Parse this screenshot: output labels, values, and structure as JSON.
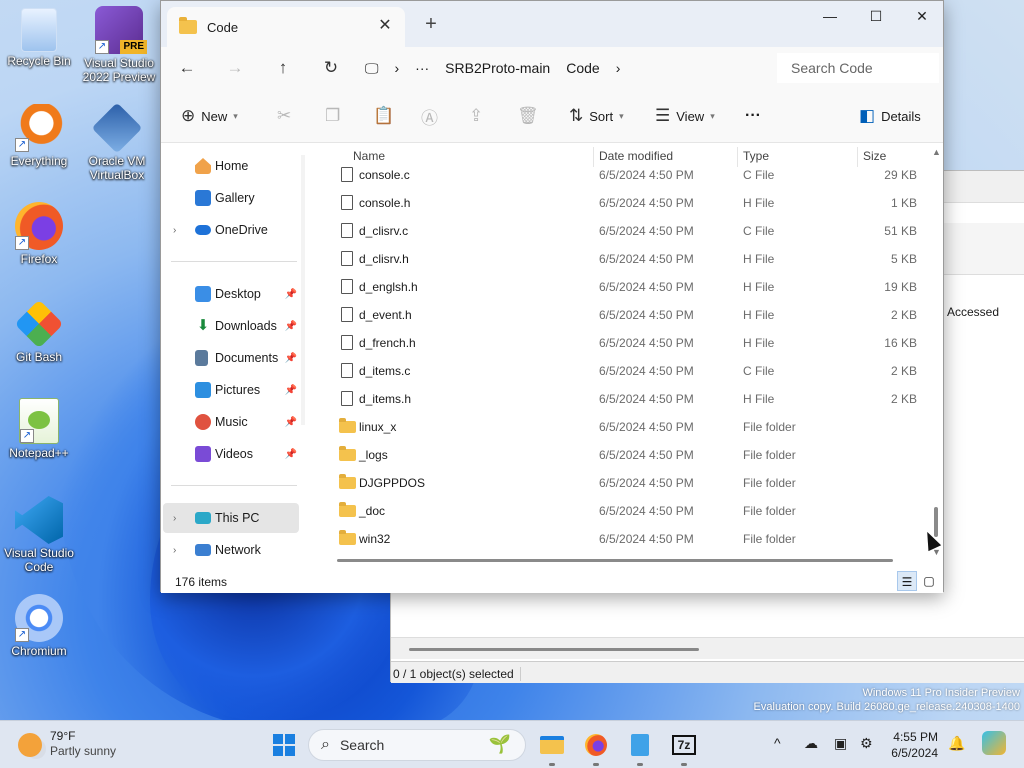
{
  "desktop": {
    "icons": [
      {
        "label": "Recycle Bin",
        "icon": "recycle-bin-icon"
      },
      {
        "label": "Visual Studio 2022 Preview",
        "icon": "visual-studio-preview-icon",
        "badge": "PRE"
      },
      {
        "label": "Everything",
        "icon": "everything-search-icon"
      },
      {
        "label": "Oracle VM VirtualBox",
        "icon": "virtualbox-icon"
      },
      {
        "label": "Firefox",
        "icon": "firefox-icon"
      },
      {
        "label": "Git Bash",
        "icon": "git-bash-icon"
      },
      {
        "label": "Notepad++",
        "icon": "notepad-plus-plus-icon"
      },
      {
        "label": "Visual Studio Code",
        "icon": "vscode-icon"
      },
      {
        "label": "Chromium",
        "icon": "chromium-icon"
      }
    ]
  },
  "background_window": {
    "column_header": "Accessed",
    "status": "0 / 1 object(s) selected"
  },
  "explorer": {
    "tab_title": "Code",
    "window_controls": {
      "minimize": "—",
      "maximize": "☐",
      "close": "✕"
    },
    "breadcrumb": [
      "SRB2Proto-main",
      "Code"
    ],
    "breadcrumb_more": "···",
    "search_placeholder": "Search Code",
    "commands": {
      "new": "New",
      "sort": "Sort",
      "view": "View",
      "more": "···",
      "details": "Details"
    },
    "nav": {
      "home": "Home",
      "gallery": "Gallery",
      "onedrive": "OneDrive",
      "desktop": "Desktop",
      "downloads": "Downloads",
      "documents": "Documents",
      "pictures": "Pictures",
      "music": "Music",
      "videos": "Videos",
      "this_pc": "This PC",
      "network": "Network"
    },
    "columns": {
      "name": "Name",
      "date": "Date modified",
      "type": "Type",
      "size": "Size"
    },
    "files": [
      {
        "name": "console.c",
        "date": "6/5/2024 4:50 PM",
        "type": "C File",
        "size": "29 KB",
        "kind": "file"
      },
      {
        "name": "console.h",
        "date": "6/5/2024 4:50 PM",
        "type": "H File",
        "size": "1 KB",
        "kind": "file"
      },
      {
        "name": "d_clisrv.c",
        "date": "6/5/2024 4:50 PM",
        "type": "C File",
        "size": "51 KB",
        "kind": "file"
      },
      {
        "name": "d_clisrv.h",
        "date": "6/5/2024 4:50 PM",
        "type": "H File",
        "size": "5 KB",
        "kind": "file"
      },
      {
        "name": "d_englsh.h",
        "date": "6/5/2024 4:50 PM",
        "type": "H File",
        "size": "19 KB",
        "kind": "file"
      },
      {
        "name": "d_event.h",
        "date": "6/5/2024 4:50 PM",
        "type": "H File",
        "size": "2 KB",
        "kind": "file"
      },
      {
        "name": "d_french.h",
        "date": "6/5/2024 4:50 PM",
        "type": "H File",
        "size": "16 KB",
        "kind": "file"
      },
      {
        "name": "d_items.c",
        "date": "6/5/2024 4:50 PM",
        "type": "C File",
        "size": "2 KB",
        "kind": "file"
      },
      {
        "name": "d_items.h",
        "date": "6/5/2024 4:50 PM",
        "type": "H File",
        "size": "2 KB",
        "kind": "file"
      },
      {
        "name": "linux_x",
        "date": "6/5/2024 4:50 PM",
        "type": "File folder",
        "size": "",
        "kind": "folder"
      },
      {
        "name": "_logs",
        "date": "6/5/2024 4:50 PM",
        "type": "File folder",
        "size": "",
        "kind": "folder"
      },
      {
        "name": "DJGPPDOS",
        "date": "6/5/2024 4:50 PM",
        "type": "File folder",
        "size": "",
        "kind": "folder"
      },
      {
        "name": "_doc",
        "date": "6/5/2024 4:50 PM",
        "type": "File folder",
        "size": "",
        "kind": "folder"
      },
      {
        "name": "win32",
        "date": "6/5/2024 4:50 PM",
        "type": "File folder",
        "size": "",
        "kind": "folder"
      }
    ],
    "item_count": "176 items"
  },
  "watermark": {
    "line1": "Windows 11 Pro Insider Preview",
    "line2": "Evaluation copy. Build 26080.ge_release.240308-1400"
  },
  "taskbar": {
    "weather_temp": "79°F",
    "weather_desc": "Partly sunny",
    "search_label": "Search",
    "time": "4:55 PM",
    "date": "6/5/2024",
    "apps": [
      "start-icon",
      "file-explorer-icon",
      "firefox-icon",
      "notepad-icon",
      "7zip-icon"
    ],
    "app_7zip_label": "7z"
  },
  "colors": {
    "accent": "#005fb8",
    "folder": "#f4c24d"
  }
}
